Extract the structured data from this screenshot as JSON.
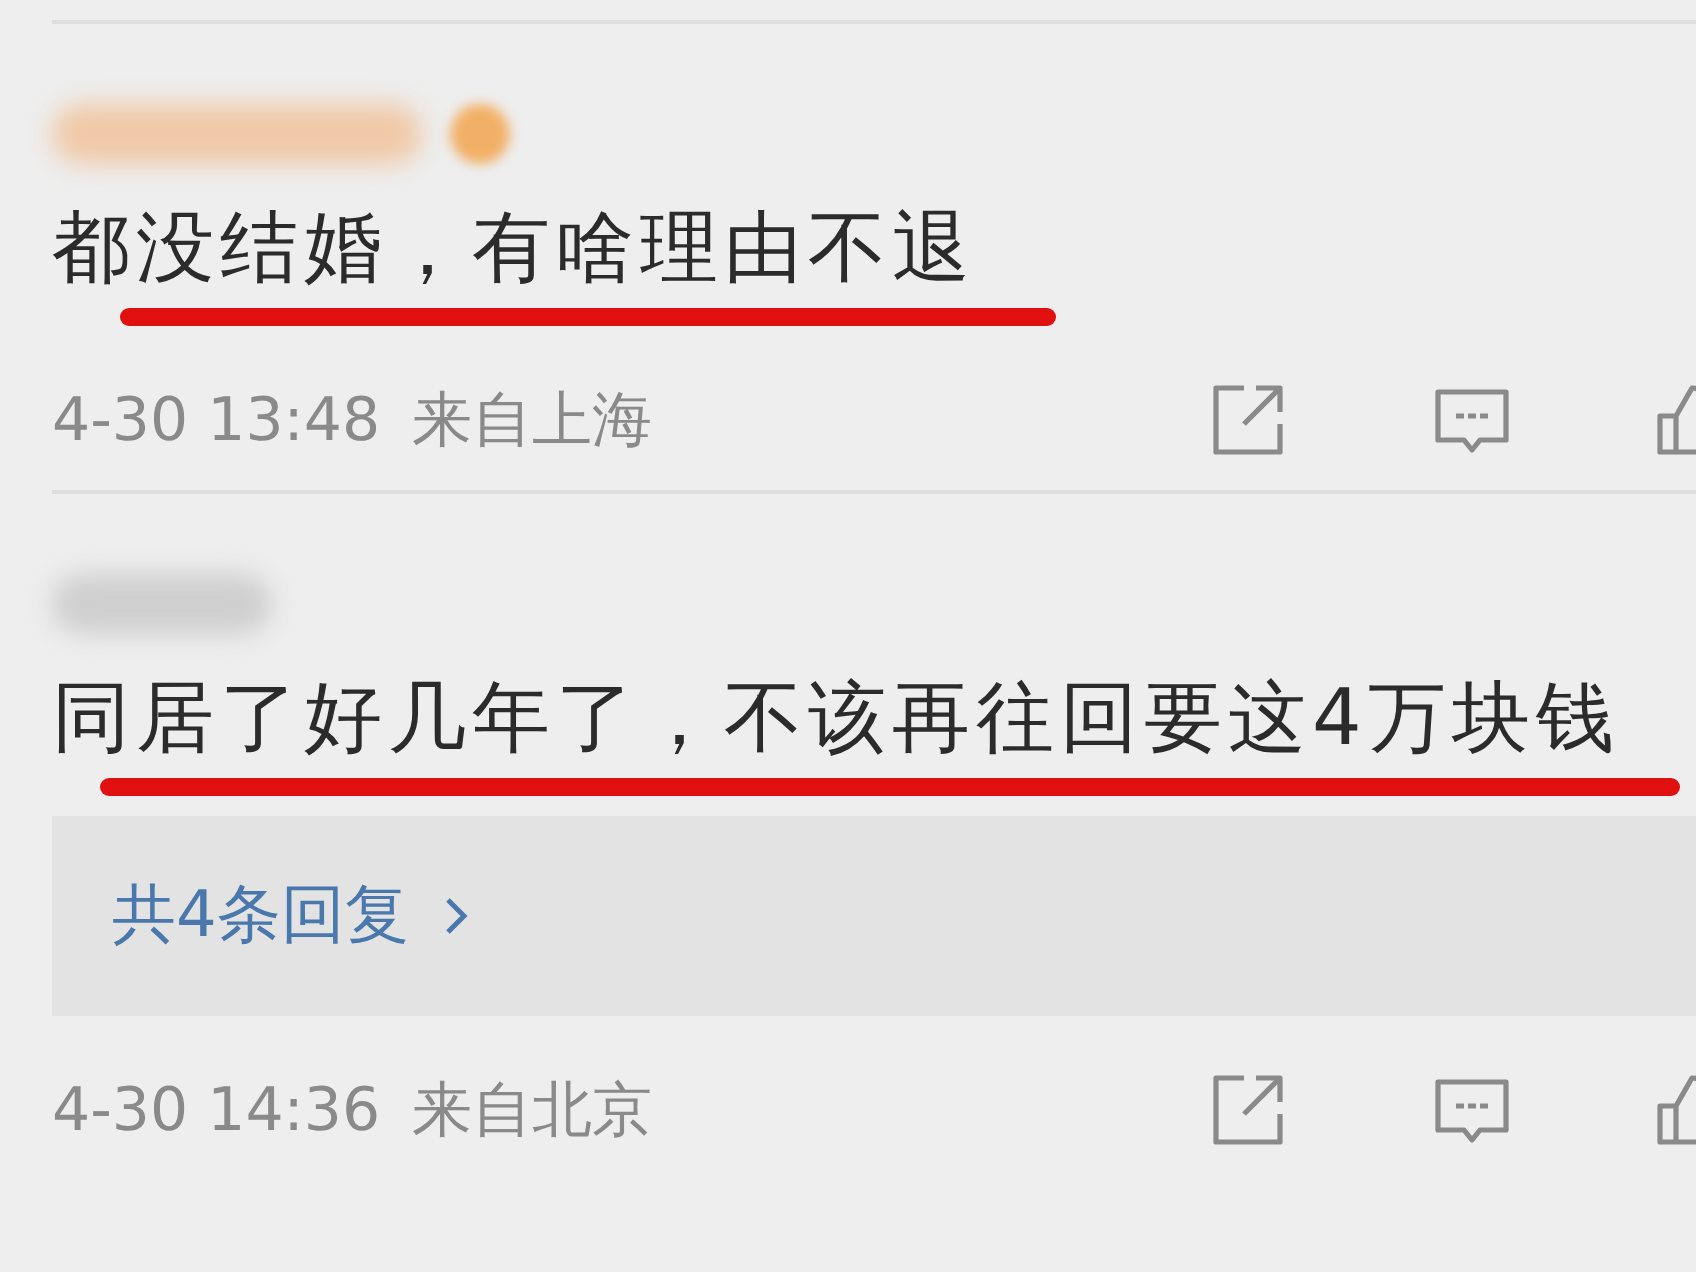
{
  "comments": [
    {
      "badge": true,
      "text": "都没结婚，有啥理由不退",
      "underlined": true,
      "time": "4-30 13:48",
      "location": "来自上海"
    },
    {
      "badge": false,
      "text": "同居了好几年了，不该再往回要这4万块钱",
      "underlined": true,
      "time": "4-30 14:36",
      "location": "来自北京",
      "replies": "共4条回复"
    }
  ]
}
